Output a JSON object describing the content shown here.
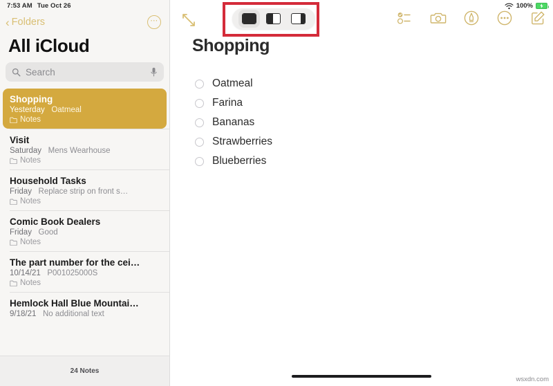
{
  "status_bar": {
    "time": "7:53 AM",
    "date": "Tue Oct 26",
    "wifi_icon": "wifi-icon",
    "battery_percent": "100%",
    "battery_icon": "battery-charging-icon"
  },
  "sidebar": {
    "back_label": "Folders",
    "back_icon": "chevron-left-icon",
    "more_icon": "ellipsis-circle-icon",
    "title": "All iCloud",
    "search": {
      "placeholder": "Search",
      "value": "",
      "search_icon": "search-icon",
      "mic_icon": "microphone-icon"
    },
    "notes": [
      {
        "title": "Shopping",
        "date": "Yesterday",
        "preview": "Oatmeal",
        "folder": "Notes",
        "selected": true
      },
      {
        "title": "Visit",
        "date": "Saturday",
        "preview": "Mens Wearhouse",
        "folder": "Notes",
        "selected": false
      },
      {
        "title": "Household Tasks",
        "date": "Friday",
        "preview": "Replace strip on front s…",
        "folder": "Notes",
        "selected": false
      },
      {
        "title": "Comic Book Dealers",
        "date": "Friday",
        "preview": "Good",
        "folder": "Notes",
        "selected": false
      },
      {
        "title": "The part number for the cei…",
        "date": "10/14/21",
        "preview": "P001025000S",
        "folder": "Notes",
        "selected": false
      },
      {
        "title": "Hemlock Hall Blue Mountai…",
        "date": "9/18/21",
        "preview": "No additional text",
        "folder": "",
        "selected": false
      }
    ],
    "footer_count": "24 Notes"
  },
  "detail": {
    "expand_icon": "expand-diagonal-arrows-icon",
    "multitask_menu": {
      "highlighted": true,
      "highlight_color": "#d42b3a",
      "options": [
        {
          "name": "full-screen",
          "selected": true
        },
        {
          "name": "split-view",
          "selected": false
        },
        {
          "name": "slide-over",
          "selected": false
        }
      ]
    },
    "toolbar_icons": [
      {
        "name": "checklist-icon"
      },
      {
        "name": "camera-icon"
      },
      {
        "name": "markup-pen-icon"
      },
      {
        "name": "more-ellipsis-icon"
      },
      {
        "name": "compose-icon"
      }
    ],
    "note": {
      "title": "Shopping",
      "checklist": [
        {
          "label": "Oatmeal",
          "checked": false
        },
        {
          "label": "Farina",
          "checked": false
        },
        {
          "label": "Bananas",
          "checked": false
        },
        {
          "label": "Strawberries",
          "checked": false
        },
        {
          "label": "Blueberries",
          "checked": false
        }
      ]
    },
    "home_indicator": "home-indicator",
    "watermark": "wsxdn.com"
  },
  "colors": {
    "accent_gold": "#d4a93f",
    "tint_gold": "#cfb56a",
    "highlight_red": "#d42b3a",
    "sidebar_bg": "#f7f6f4"
  }
}
